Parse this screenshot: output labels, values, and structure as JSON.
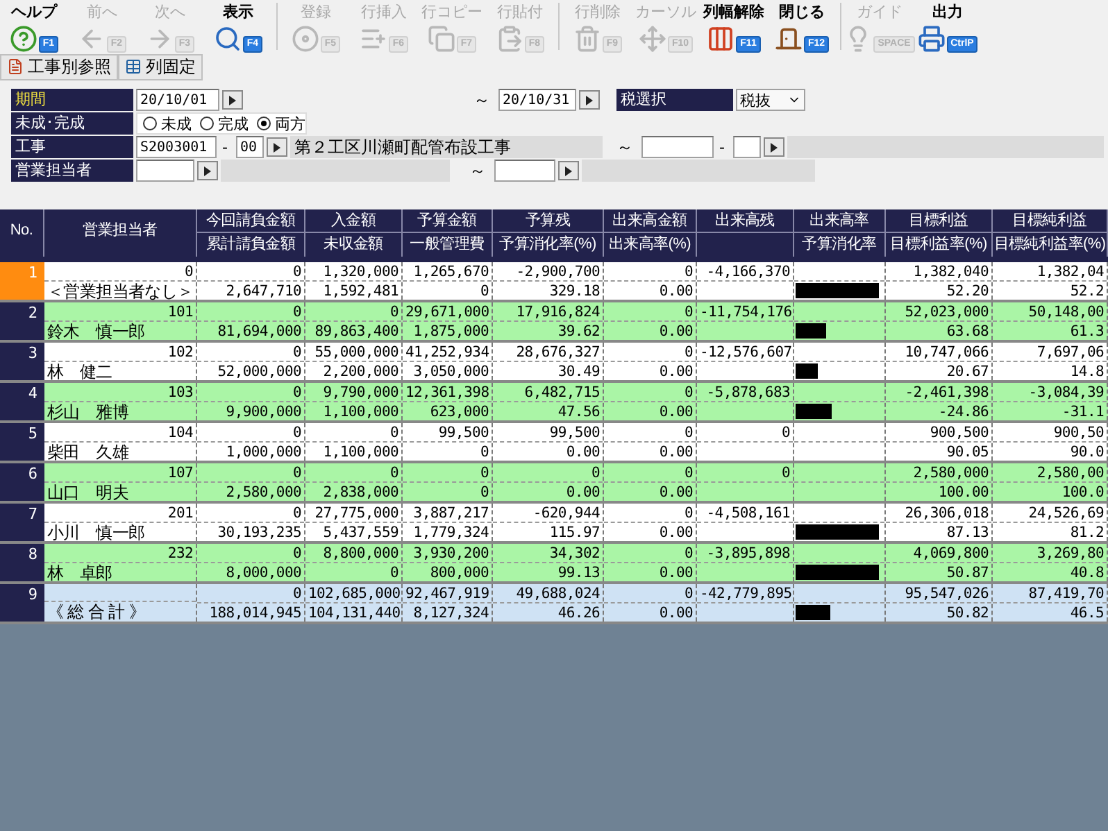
{
  "toolbar": [
    {
      "buttons": [
        {
          "label": "ヘルプ",
          "key": "F1",
          "kind": "help",
          "disabled": false
        },
        {
          "label": "前へ",
          "key": "F2",
          "kind": "back",
          "disabled": true
        },
        {
          "label": "次へ",
          "key": "F3",
          "kind": "forward",
          "disabled": true
        },
        {
          "label": "表示",
          "key": "F4",
          "kind": "search",
          "disabled": false
        }
      ]
    },
    {
      "buttons": [
        {
          "label": "登録",
          "key": "F5",
          "kind": "register",
          "disabled": true
        },
        {
          "label": "行挿入",
          "key": "F6",
          "kind": "insert",
          "disabled": true
        },
        {
          "label": "行コピー",
          "key": "F7",
          "kind": "copy",
          "disabled": true
        },
        {
          "label": "行貼付",
          "key": "F8",
          "kind": "paste",
          "disabled": true
        }
      ]
    },
    {
      "buttons": [
        {
          "label": "行削除",
          "key": "F9",
          "kind": "delete",
          "disabled": true
        },
        {
          "label": "カーソル",
          "key": "F10",
          "kind": "cursor",
          "disabled": true
        },
        {
          "label": "列幅解除",
          "key": "F11",
          "kind": "columns",
          "disabled": false
        },
        {
          "label": "閉じる",
          "key": "F12",
          "kind": "close",
          "disabled": false
        }
      ]
    },
    {
      "buttons": [
        {
          "label": "ガイド",
          "key": "SPACE",
          "kind": "guide",
          "disabled": true
        },
        {
          "label": "出力",
          "key": "CtrlP",
          "kind": "print",
          "disabled": false
        }
      ]
    }
  ],
  "subbar": [
    {
      "label": "工事別参照",
      "kind": "document"
    },
    {
      "label": "列固定",
      "kind": "table"
    }
  ],
  "filters": {
    "period": {
      "label": "期間",
      "from": "20/10/01",
      "range_mark": "～",
      "to": "20/10/31"
    },
    "tax": {
      "label": "税選択",
      "value": "税抜"
    },
    "status": {
      "label": "未成･完成",
      "options": [
        {
          "label": "未成",
          "selected": false
        },
        {
          "label": "完成",
          "selected": false
        },
        {
          "label": "両方",
          "selected": true
        }
      ]
    },
    "construction": {
      "label": "工事",
      "code": "S2003001",
      "dash": "-",
      "sub": "00",
      "name": "第２工区川瀬町配管布設工事",
      "range_mark": "～",
      "dash_2": "-"
    },
    "sales_rep": {
      "label": "営業担当者",
      "range_mark": "～"
    }
  },
  "table": {
    "columns": [
      {
        "top": "No."
      },
      {
        "top": "営業担当者"
      },
      {
        "top": "今回請負金額",
        "bottom": "累計請負金額"
      },
      {
        "top": "入金額",
        "bottom": "未収金額"
      },
      {
        "top": "予算金額",
        "bottom": "一般管理費"
      },
      {
        "top": "予算残",
        "bottom": "予算消化率(%)"
      },
      {
        "top": "出来高金額",
        "bottom": "出来高率(%)"
      },
      {
        "top": "出来高残"
      },
      {
        "top": "出来高率",
        "bottom": "予算消化率"
      },
      {
        "top": "目標利益",
        "bottom": "目標利益率(%)"
      },
      {
        "top": "目標純利益",
        "bottom": "目標純利益率(%)"
      }
    ],
    "rows": [
      {
        "kind": "plain",
        "selected": true,
        "level": 0.95,
        "cells": [
          [
            "1"
          ],
          [
            "0",
            "＜営業担当者なし＞"
          ],
          [
            "0",
            "2,647,710"
          ],
          [
            "1,320,000",
            "1,592,481"
          ],
          [
            "1,265,670",
            "0"
          ],
          [
            "-2,900,700",
            "329.18"
          ],
          [
            "0",
            "0.00"
          ],
          [
            "-4,166,370",
            ""
          ],
          [
            "",
            ""
          ],
          [
            "1,382,040",
            "52.20"
          ],
          [
            "1,382,04",
            "52.2"
          ]
        ]
      },
      {
        "kind": "striped",
        "selected": false,
        "level": 0.35,
        "cells": [
          [
            "2"
          ],
          [
            "101",
            "鈴木　慎一郎"
          ],
          [
            "0",
            "81,694,000"
          ],
          [
            "0",
            "89,863,400"
          ],
          [
            "29,671,000",
            "1,875,000"
          ],
          [
            "17,916,824",
            "39.62"
          ],
          [
            "0",
            "0.00"
          ],
          [
            "-11,754,176",
            ""
          ],
          [
            "",
            ""
          ],
          [
            "52,023,000",
            "63.68"
          ],
          [
            "50,148,00",
            "61.3"
          ]
        ]
      },
      {
        "kind": "plain",
        "selected": false,
        "level": 0.25,
        "cells": [
          [
            "3"
          ],
          [
            "102",
            "林　健二"
          ],
          [
            "0",
            "52,000,000"
          ],
          [
            "55,000,000",
            "2,200,000"
          ],
          [
            "41,252,934",
            "3,050,000"
          ],
          [
            "28,676,327",
            "30.49"
          ],
          [
            "0",
            "0.00"
          ],
          [
            "-12,576,607",
            ""
          ],
          [
            "",
            ""
          ],
          [
            "10,747,066",
            "20.67"
          ],
          [
            "7,697,06",
            "14.8"
          ]
        ]
      },
      {
        "kind": "striped",
        "selected": false,
        "level": 0.42,
        "cells": [
          [
            "4"
          ],
          [
            "103",
            "杉山　雅博"
          ],
          [
            "0",
            "9,900,000"
          ],
          [
            "9,790,000",
            "1,100,000"
          ],
          [
            "12,361,398",
            "623,000"
          ],
          [
            "6,482,715",
            "47.56"
          ],
          [
            "0",
            "0.00"
          ],
          [
            "-5,878,683",
            ""
          ],
          [
            "",
            ""
          ],
          [
            "-2,461,398",
            "-24.86"
          ],
          [
            "-3,084,39",
            "-31.1"
          ]
        ]
      },
      {
        "kind": "plain",
        "selected": false,
        "cells": [
          [
            "5"
          ],
          [
            "104",
            "柴田　久雄"
          ],
          [
            "0",
            "1,000,000"
          ],
          [
            "0",
            "1,100,000"
          ],
          [
            "99,500",
            "0"
          ],
          [
            "99,500",
            "0.00"
          ],
          [
            "0",
            "0.00"
          ],
          [
            "0",
            ""
          ],
          [
            "",
            ""
          ],
          [
            "900,500",
            "90.05"
          ],
          [
            "900,50",
            "90.0"
          ]
        ]
      },
      {
        "kind": "striped",
        "selected": false,
        "cells": [
          [
            "6"
          ],
          [
            "107",
            "山口　明夫"
          ],
          [
            "0",
            "2,580,000"
          ],
          [
            "0",
            "2,838,000"
          ],
          [
            "0",
            "0"
          ],
          [
            "0",
            "0.00"
          ],
          [
            "0",
            "0.00"
          ],
          [
            "0",
            ""
          ],
          [
            "",
            ""
          ],
          [
            "2,580,000",
            "100.00"
          ],
          [
            "2,580,00",
            "100.0"
          ]
        ]
      },
      {
        "kind": "plain",
        "selected": false,
        "level": 0.95,
        "cells": [
          [
            "7"
          ],
          [
            "201",
            "小川　慎一郎"
          ],
          [
            "0",
            "30,193,235"
          ],
          [
            "27,775,000",
            "5,437,559"
          ],
          [
            "3,887,217",
            "1,779,324"
          ],
          [
            "-620,944",
            "115.97"
          ],
          [
            "0",
            "0.00"
          ],
          [
            "-4,508,161",
            ""
          ],
          [
            "",
            ""
          ],
          [
            "26,306,018",
            "87.13"
          ],
          [
            "24,526,69",
            "81.2"
          ]
        ]
      },
      {
        "kind": "striped",
        "selected": false,
        "level": 0.95,
        "cells": [
          [
            "8"
          ],
          [
            "232",
            "林　卓郎"
          ],
          [
            "0",
            "8,000,000"
          ],
          [
            "8,800,000",
            "0"
          ],
          [
            "3,930,200",
            "800,000"
          ],
          [
            "34,302",
            "99.13"
          ],
          [
            "0",
            "0.00"
          ],
          [
            "-3,895,898",
            ""
          ],
          [
            "",
            ""
          ],
          [
            "4,069,800",
            "50.87"
          ],
          [
            "3,269,80",
            "40.8"
          ]
        ]
      },
      {
        "kind": "total",
        "selected": false,
        "level": 0.4,
        "cells": [
          [
            "9"
          ],
          [
            "",
            "《 総 合 計 》"
          ],
          [
            "0",
            "188,014,945"
          ],
          [
            "102,685,000",
            "104,131,440"
          ],
          [
            "92,467,919",
            "8,127,324"
          ],
          [
            "49,688,024",
            "46.26"
          ],
          [
            "0",
            "0.00"
          ],
          [
            "-42,779,895",
            ""
          ],
          [
            "",
            ""
          ],
          [
            "95,547,026",
            "50.82"
          ],
          [
            "87,419,70",
            "46.5"
          ]
        ]
      }
    ]
  }
}
